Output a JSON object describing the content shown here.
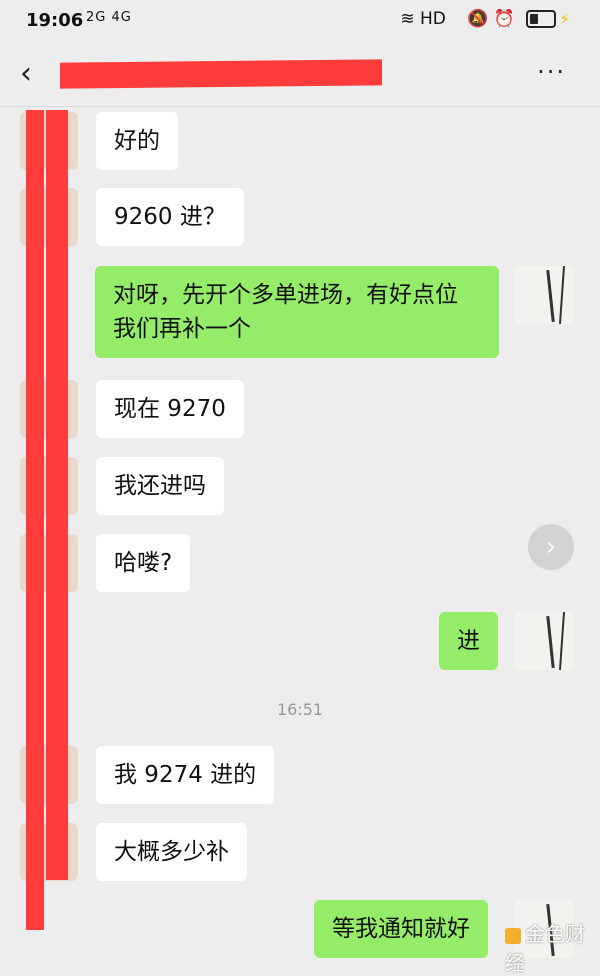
{
  "status_bar": {
    "time": "19:06",
    "signal_text": "2G 4G",
    "network": "HD",
    "icons": [
      "mute-icon",
      "alarm-icon",
      "battery-icon",
      "charging-icon"
    ]
  },
  "header": {
    "back_icon": "chevron-left-icon",
    "more_label": "···",
    "title_redacted": true
  },
  "messages": [
    {
      "side": "in",
      "text": "好的"
    },
    {
      "side": "in",
      "text": "9260 进？"
    },
    {
      "side": "out",
      "text": "对呀，先开个多单进场，有好点位\n我们再补一个"
    },
    {
      "side": "in",
      "text": "现在 9270"
    },
    {
      "side": "in",
      "text": "我还进吗"
    },
    {
      "side": "in",
      "text": "哈喽?"
    },
    {
      "side": "out",
      "text": "进"
    },
    {
      "side": "in",
      "text": "我 9274 进的"
    },
    {
      "side": "in",
      "text": "大概多少补"
    },
    {
      "side": "out",
      "text": "等我通知就好"
    }
  ],
  "timestamp": "16:51",
  "forward_icon": "chevron-right-icon",
  "watermark": "金色财经",
  "colors": {
    "outgoing_bubble": "#95ec69",
    "incoming_bubble": "#ffffff",
    "redaction": "#ff3b3b",
    "background": "#ededed"
  }
}
